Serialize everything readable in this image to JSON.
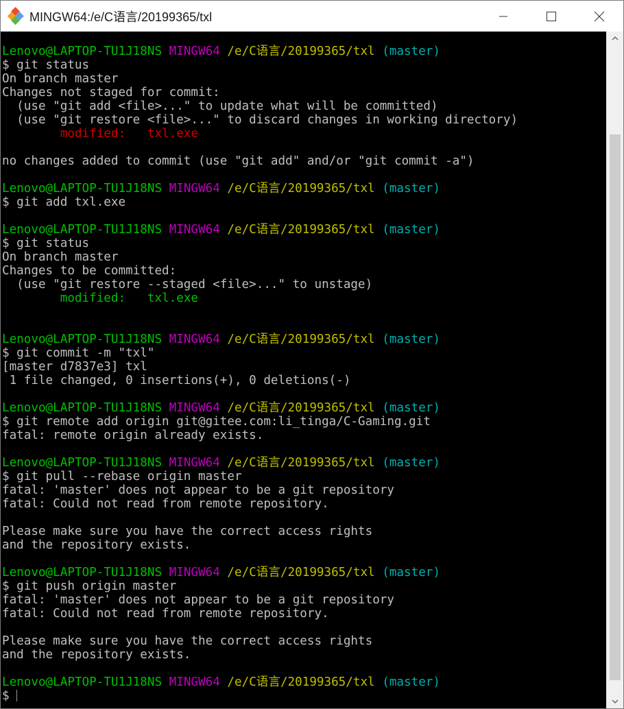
{
  "window": {
    "title": "MINGW64:/e/C语言/20199365/txl",
    "app_icon": "git-bash-icon",
    "controls": [
      "minimize-icon",
      "maximize-icon",
      "close-icon"
    ]
  },
  "scrollbar": {
    "up_icon": "scroll-up-arrow-icon",
    "down_icon": "scroll-down-arrow-icon",
    "thumb_start_fraction": 0.137,
    "thumb_length_fraction": 0.841
  },
  "colors": {
    "default": "#c0c0c0",
    "user": "#00c000",
    "system": "#c000c0",
    "path": "#c0c000",
    "branch": "#00b0b0",
    "red": "#d00000",
    "green": "#00c000"
  },
  "terminal": {
    "lines": [
      [
        {
          "t": "Lenovo@LAPTOP-TU1J18NS",
          "c": "user"
        },
        {
          "t": " "
        },
        {
          "t": "MINGW64",
          "c": "system"
        },
        {
          "t": " "
        },
        {
          "t": "/e/C语言/20199365/txl",
          "c": "path"
        },
        {
          "t": " "
        },
        {
          "t": "(master)",
          "c": "branch"
        }
      ],
      [
        {
          "t": "$ git status"
        }
      ],
      [
        {
          "t": "On branch master"
        }
      ],
      [
        {
          "t": "Changes not staged for commit:"
        }
      ],
      [
        {
          "t": "  (use \"git add <file>...\" to update what will be committed)"
        }
      ],
      [
        {
          "t": "  (use \"git restore <file>...\" to discard changes in working directory)"
        }
      ],
      [
        {
          "t": "        "
        },
        {
          "t": "modified:   txl.exe",
          "c": "red"
        }
      ],
      [],
      [
        {
          "t": "no changes added to commit (use \"git add\" and/or \"git commit -a\")"
        }
      ],
      [],
      [
        {
          "t": "Lenovo@LAPTOP-TU1J18NS",
          "c": "user"
        },
        {
          "t": " "
        },
        {
          "t": "MINGW64",
          "c": "system"
        },
        {
          "t": " "
        },
        {
          "t": "/e/C语言/20199365/txl",
          "c": "path"
        },
        {
          "t": " "
        },
        {
          "t": "(master)",
          "c": "branch"
        }
      ],
      [
        {
          "t": "$ git add txl.exe"
        }
      ],
      [],
      [
        {
          "t": "Lenovo@LAPTOP-TU1J18NS",
          "c": "user"
        },
        {
          "t": " "
        },
        {
          "t": "MINGW64",
          "c": "system"
        },
        {
          "t": " "
        },
        {
          "t": "/e/C语言/20199365/txl",
          "c": "path"
        },
        {
          "t": " "
        },
        {
          "t": "(master)",
          "c": "branch"
        }
      ],
      [
        {
          "t": "$ git status"
        }
      ],
      [
        {
          "t": "On branch master"
        }
      ],
      [
        {
          "t": "Changes to be committed:"
        }
      ],
      [
        {
          "t": "  (use \"git restore --staged <file>...\" to unstage)"
        }
      ],
      [
        {
          "t": "        "
        },
        {
          "t": "modified:   txl.exe",
          "c": "green"
        }
      ],
      [],
      [],
      [
        {
          "t": "Lenovo@LAPTOP-TU1J18NS",
          "c": "user"
        },
        {
          "t": " "
        },
        {
          "t": "MINGW64",
          "c": "system"
        },
        {
          "t": " "
        },
        {
          "t": "/e/C语言/20199365/txl",
          "c": "path"
        },
        {
          "t": " "
        },
        {
          "t": "(master)",
          "c": "branch"
        }
      ],
      [
        {
          "t": "$ git commit -m \"txl\""
        }
      ],
      [
        {
          "t": "[master d7837e3] txl"
        }
      ],
      [
        {
          "t": " 1 file changed, 0 insertions(+), 0 deletions(-)"
        }
      ],
      [],
      [
        {
          "t": "Lenovo@LAPTOP-TU1J18NS",
          "c": "user"
        },
        {
          "t": " "
        },
        {
          "t": "MINGW64",
          "c": "system"
        },
        {
          "t": " "
        },
        {
          "t": "/e/C语言/20199365/txl",
          "c": "path"
        },
        {
          "t": " "
        },
        {
          "t": "(master)",
          "c": "branch"
        }
      ],
      [
        {
          "t": "$ git remote add origin git@gitee.com:li_tinga/C-Gaming.git"
        }
      ],
      [
        {
          "t": "fatal: remote origin already exists."
        }
      ],
      [],
      [
        {
          "t": "Lenovo@LAPTOP-TU1J18NS",
          "c": "user"
        },
        {
          "t": " "
        },
        {
          "t": "MINGW64",
          "c": "system"
        },
        {
          "t": " "
        },
        {
          "t": "/e/C语言/20199365/txl",
          "c": "path"
        },
        {
          "t": " "
        },
        {
          "t": "(master)",
          "c": "branch"
        }
      ],
      [
        {
          "t": "$ git pull --rebase origin master"
        }
      ],
      [
        {
          "t": "fatal: 'master' does not appear to be a git repository"
        }
      ],
      [
        {
          "t": "fatal: Could not read from remote repository."
        }
      ],
      [],
      [
        {
          "t": "Please make sure you have the correct access rights"
        }
      ],
      [
        {
          "t": "and the repository exists."
        }
      ],
      [],
      [
        {
          "t": "Lenovo@LAPTOP-TU1J18NS",
          "c": "user"
        },
        {
          "t": " "
        },
        {
          "t": "MINGW64",
          "c": "system"
        },
        {
          "t": " "
        },
        {
          "t": "/e/C语言/20199365/txl",
          "c": "path"
        },
        {
          "t": " "
        },
        {
          "t": "(master)",
          "c": "branch"
        }
      ],
      [
        {
          "t": "$ git push origin master"
        }
      ],
      [
        {
          "t": "fatal: 'master' does not appear to be a git repository"
        }
      ],
      [
        {
          "t": "fatal: Could not read from remote repository."
        }
      ],
      [],
      [
        {
          "t": "Please make sure you have the correct access rights"
        }
      ],
      [
        {
          "t": "and the repository exists."
        }
      ],
      [],
      [
        {
          "t": "Lenovo@LAPTOP-TU1J18NS",
          "c": "user"
        },
        {
          "t": " "
        },
        {
          "t": "MINGW64",
          "c": "system"
        },
        {
          "t": " "
        },
        {
          "t": "/e/C语言/20199365/txl",
          "c": "path"
        },
        {
          "t": " "
        },
        {
          "t": "(master)",
          "c": "branch"
        }
      ],
      [
        {
          "t": "$ "
        }
      ]
    ]
  }
}
